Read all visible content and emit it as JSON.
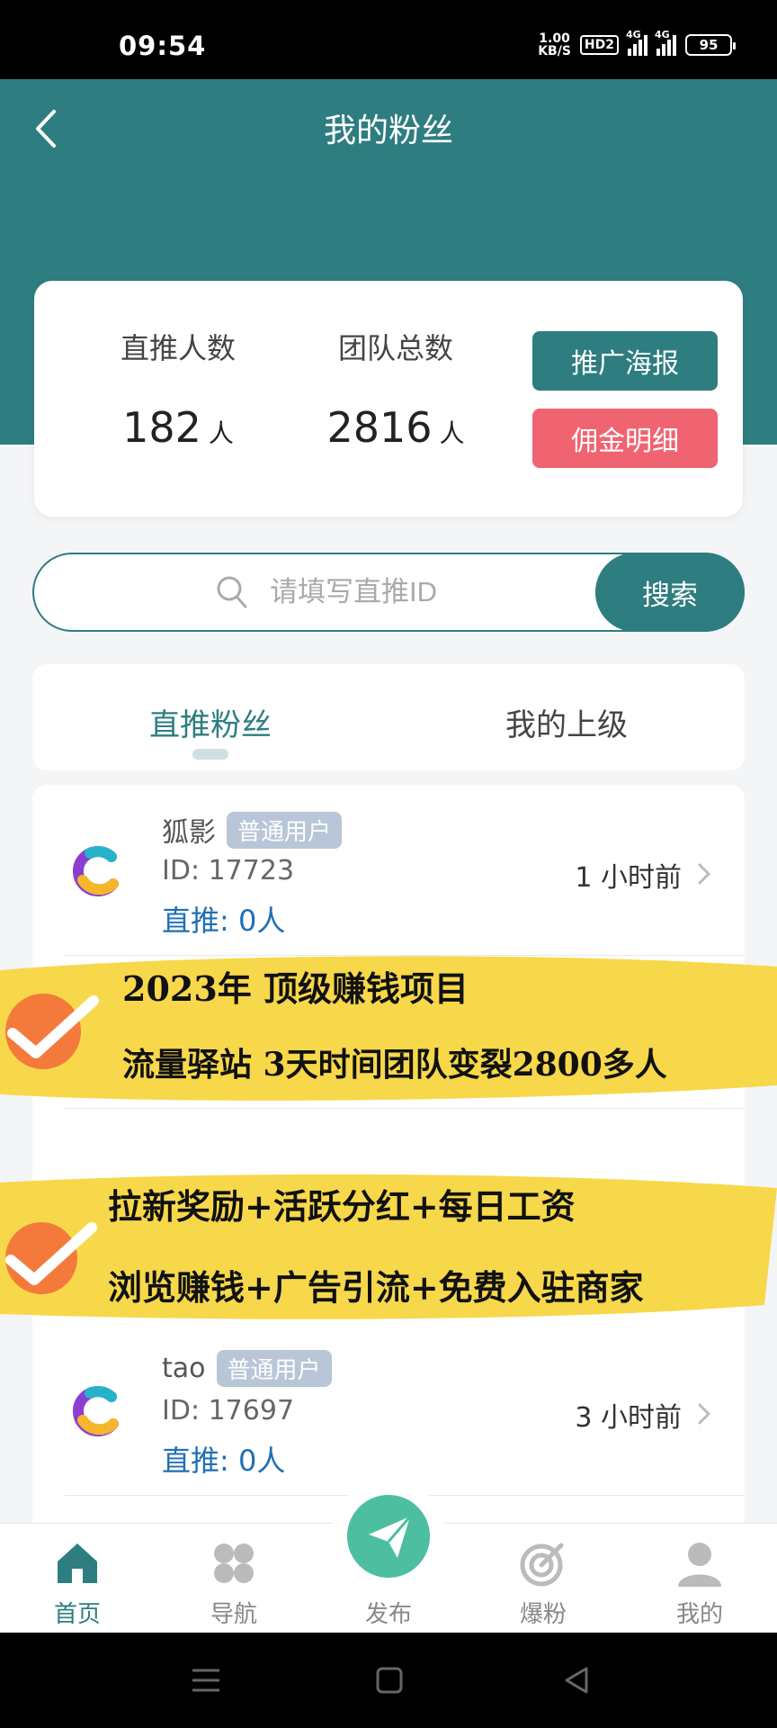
{
  "status_bar": {
    "time": "09:54",
    "net_speed_value": "1.00",
    "net_speed_unit": "KB/S",
    "hd_label": "HD2",
    "signal_label_1": "4G",
    "signal_label_2": "4G",
    "battery": "95"
  },
  "header": {
    "title": "我的粉丝"
  },
  "stats": {
    "direct_label": "直推人数",
    "direct_value": "182",
    "team_label": "团队总数",
    "team_value": "2816",
    "unit": "人",
    "poster_button": "推广海报",
    "commission_button": "佣金明细"
  },
  "search": {
    "placeholder": "请填写直推ID",
    "button": "搜索"
  },
  "tabs": [
    {
      "label": "直推粉丝"
    },
    {
      "label": "我的上级"
    }
  ],
  "fans": [
    {
      "name": "狐影",
      "badge": "普通用户",
      "id": "ID: 17723",
      "direct": "直推: 0人",
      "time": "1 小时前"
    },
    {
      "name": "tao",
      "badge": "普通用户",
      "id": "ID: 17697",
      "direct": "直推: 0人",
      "time": "3 小时前"
    }
  ],
  "overlay": {
    "line1": "2023年 顶级赚钱项目",
    "line2": "流量驿站 3天时间团队变裂2800多人",
    "line3": "拉新奖励+活跃分红+每日工资",
    "line4": "浏览赚钱+广告引流+免费入驻商家",
    "highlight_color": "#f7d84a",
    "check_color": "#f47a3c"
  },
  "bottom_nav": [
    {
      "label": "首页",
      "icon": "home-icon"
    },
    {
      "label": "导航",
      "icon": "grid-icon"
    },
    {
      "label": "发布",
      "icon": "send-icon"
    },
    {
      "label": "爆粉",
      "icon": "target-icon"
    },
    {
      "label": "我的",
      "icon": "user-icon"
    }
  ],
  "colors": {
    "primary": "#2e7d80",
    "danger": "#f06471",
    "link": "#1f6fb5"
  }
}
